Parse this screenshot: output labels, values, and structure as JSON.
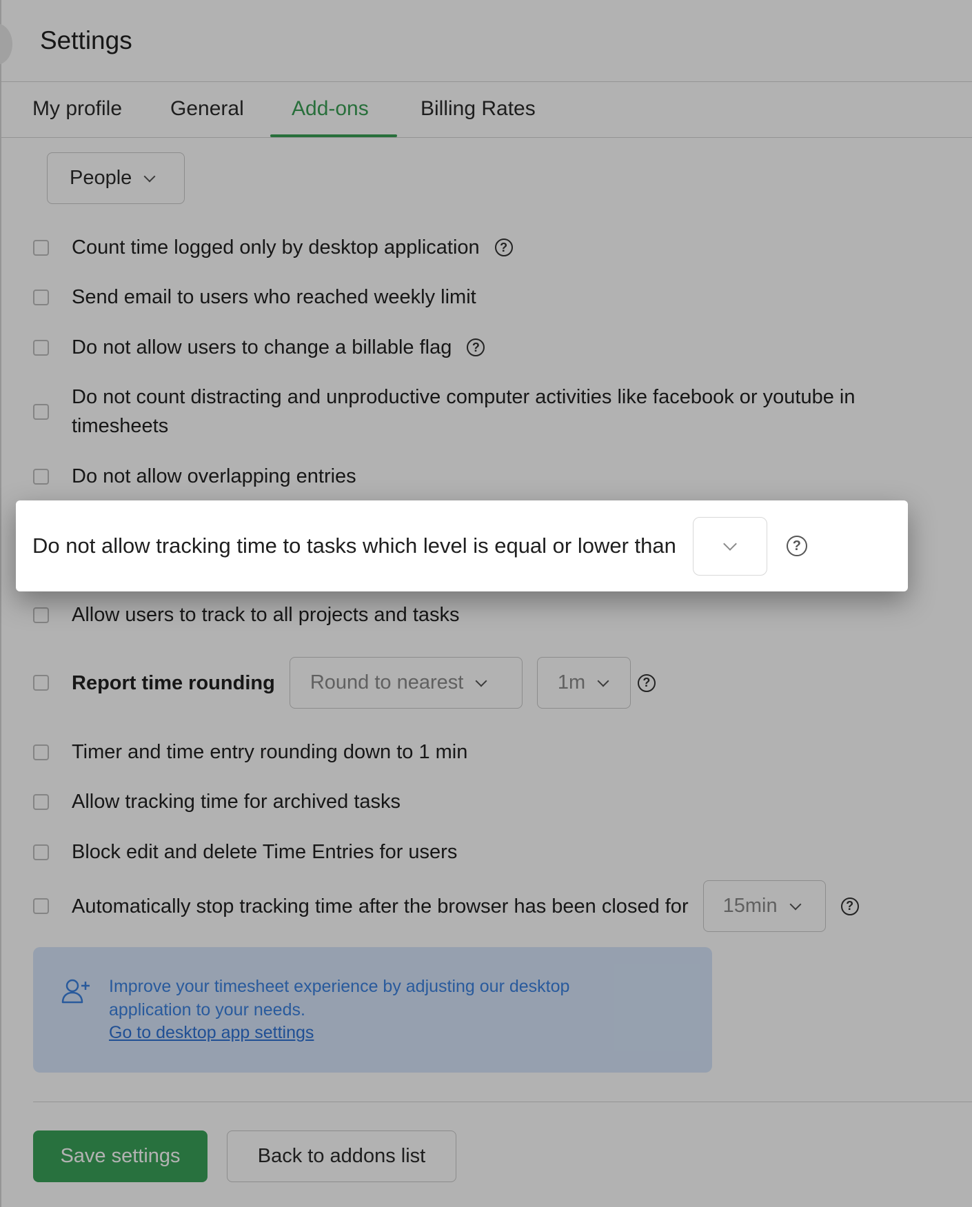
{
  "page": {
    "title": "Settings"
  },
  "tabs": [
    {
      "label": "My profile",
      "active": false
    },
    {
      "label": "General",
      "active": false
    },
    {
      "label": "Add-ons",
      "active": true
    },
    {
      "label": "Billing Rates",
      "active": false
    }
  ],
  "scope_select": {
    "value": "People"
  },
  "options": [
    {
      "label": "Count time logged only by desktop application",
      "checked": false,
      "help": true
    },
    {
      "label": "Send email to users who reached weekly limit",
      "checked": false
    },
    {
      "label": "Do not allow users to change a billable flag",
      "checked": false,
      "help": true
    },
    {
      "label": "Do not count distracting and unproductive computer activities like facebook or youtube in timesheets",
      "checked": false
    },
    {
      "label": "Do not allow overlapping entries",
      "checked": false
    },
    {
      "label": "Allow users to track to all projects and tasks",
      "checked": false
    },
    {
      "label": "Report time rounding",
      "checked": false,
      "help": true,
      "rounding_mode": "Round to nearest",
      "rounding_step": "1m"
    },
    {
      "label": "Timer and time entry rounding down to 1 min",
      "checked": false
    },
    {
      "label": "Allow tracking time for archived tasks",
      "checked": false
    },
    {
      "label": "Block edit and delete Time Entries for users",
      "checked": false
    },
    {
      "label": "Automatically stop tracking time after the browser has been closed for",
      "checked": false,
      "help": true,
      "duration": "15min"
    }
  ],
  "highlighted_option": {
    "label": "Do not allow tracking time to tasks which level is equal or lower than",
    "level_value": "",
    "help": true
  },
  "info_box": {
    "text": "Improve your timesheet experience by adjusting our desktop application to your needs.",
    "link": "Go to desktop app settings",
    "icon": "user-plus-icon"
  },
  "footer": {
    "save_label": "Save settings",
    "back_label": "Back to addons list"
  },
  "colors": {
    "accent": "#3a9f55",
    "info_bg": "#d7e6fb",
    "info_text": "#3b82e0",
    "save_bg": "#3aa35a"
  }
}
